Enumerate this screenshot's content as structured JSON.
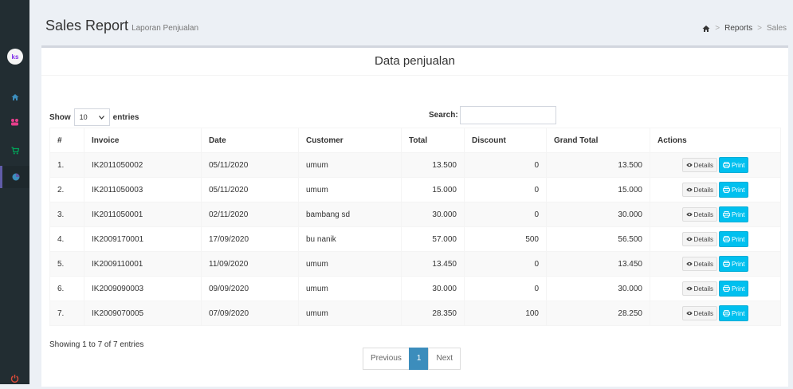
{
  "sidebar": {
    "logo": "ks",
    "items": [
      {
        "icon": "home-icon",
        "color": "#3c8dbc"
      },
      {
        "icon": "users-icon",
        "color": "#e83e8c"
      },
      {
        "icon": "cart-icon",
        "color": "#00a65a"
      },
      {
        "icon": "pie-chart-icon",
        "color": "#3c8dbc",
        "active": true
      }
    ],
    "logout_icon": "power-icon"
  },
  "header": {
    "title": "Sales Report",
    "subtitle": "Laporan Penjualan",
    "breadcrumb": [
      "Reports",
      "Sales"
    ]
  },
  "box": {
    "title": "Data penjualan",
    "show_label": "Show",
    "entries_label": "entries",
    "page_length": "10",
    "search_label": "Search:",
    "search_value": ""
  },
  "table": {
    "columns": [
      "#",
      "Invoice",
      "Date",
      "Customer",
      "Total",
      "Discount",
      "Grand Total",
      "Actions"
    ],
    "rows": [
      {
        "no": "1.",
        "invoice": "IK2011050002",
        "date": "05/11/2020",
        "customer": "umum",
        "total": "13.500",
        "discount": "0",
        "grand_total": "13.500"
      },
      {
        "no": "2.",
        "invoice": "IK2011050003",
        "date": "05/11/2020",
        "customer": "umum",
        "total": "15.000",
        "discount": "0",
        "grand_total": "15.000"
      },
      {
        "no": "3.",
        "invoice": "IK2011050001",
        "date": "02/11/2020",
        "customer": "bambang sd",
        "total": "30.000",
        "discount": "0",
        "grand_total": "30.000"
      },
      {
        "no": "4.",
        "invoice": "IK2009170001",
        "date": "17/09/2020",
        "customer": "bu nanik",
        "total": "57.000",
        "discount": "500",
        "grand_total": "56.500"
      },
      {
        "no": "5.",
        "invoice": "IK2009110001",
        "date": "11/09/2020",
        "customer": "umum",
        "total": "13.450",
        "discount": "0",
        "grand_total": "13.450"
      },
      {
        "no": "6.",
        "invoice": "IK2009090003",
        "date": "09/09/2020",
        "customer": "umum",
        "total": "30.000",
        "discount": "0",
        "grand_total": "30.000"
      },
      {
        "no": "7.",
        "invoice": "IK2009070005",
        "date": "07/09/2020",
        "customer": "umum",
        "total": "28.350",
        "discount": "100",
        "grand_total": "28.250"
      }
    ],
    "details_label": "Details",
    "print_label": "Print"
  },
  "footer": {
    "info": "Showing 1 to 7 of 7 entries",
    "prev_label": "Previous",
    "current_page": "1",
    "next_label": "Next"
  },
  "colors": {
    "sidebar_bg": "#222d32",
    "accent_blue": "#3c8dbc",
    "print_button": "#00c0ef"
  }
}
